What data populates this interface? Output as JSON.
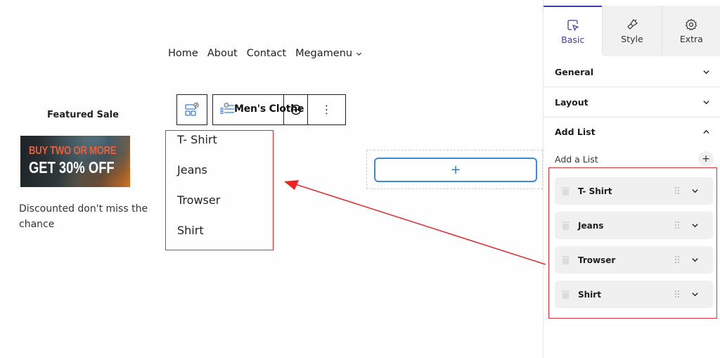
{
  "nav": {
    "items": [
      {
        "label": "Home"
      },
      {
        "label": "About"
      },
      {
        "label": "Contact"
      },
      {
        "label": "Megamenu",
        "has_dropdown": true
      }
    ]
  },
  "featured": {
    "title": "Featured Sale",
    "banner": {
      "line1": "BUY TWO OR MORE",
      "line2": "GET 30% OFF"
    },
    "description": "Discounted don't miss the chance"
  },
  "toolbar": {
    "block_title": "Men's Clothe",
    "add_label": "+",
    "more_label": "⋮"
  },
  "canvas_list": {
    "items": [
      "T- Shirt",
      "Jeans",
      "Trowser",
      "Shirt"
    ]
  },
  "appender": {
    "label": "+"
  },
  "colors": {
    "accent": "#3c3fa8",
    "appender_border": "#3b8ad9",
    "annotation_red": "#e0323a"
  },
  "sidebar": {
    "tabs": [
      {
        "label": "Basic",
        "icon": "cursor-select-icon",
        "active": true
      },
      {
        "label": "Style",
        "icon": "paintbrush-icon",
        "active": false
      },
      {
        "label": "Extra",
        "icon": "gear-icon",
        "active": false
      }
    ],
    "panels": {
      "general": "General",
      "layout": "Layout",
      "add_list": "Add List"
    },
    "add_a_list_label": "Add a List",
    "add_button_label": "+",
    "list_items": [
      {
        "label": "T- Shirt"
      },
      {
        "label": "Jeans"
      },
      {
        "label": "Trowser"
      },
      {
        "label": "Shirt"
      }
    ]
  }
}
